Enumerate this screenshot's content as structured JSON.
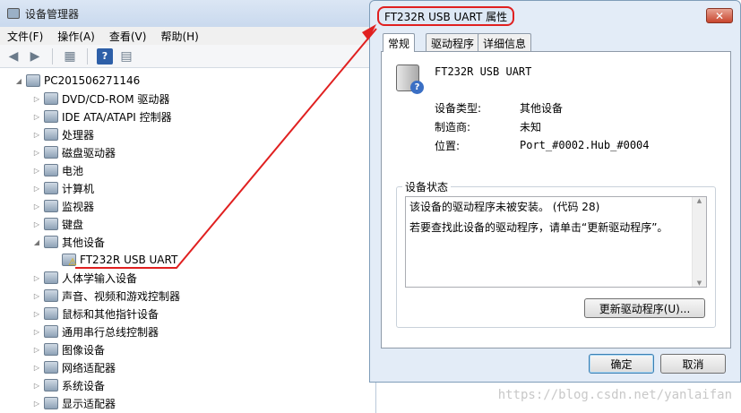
{
  "device_manager": {
    "title": "设备管理器",
    "menu": [
      "文件(F)",
      "操作(A)",
      "查看(V)",
      "帮助(H)"
    ],
    "root": "PC201506271146",
    "tree": [
      {
        "label": "DVD/CD-ROM 驱动器",
        "icon": "dvd-drive-icon"
      },
      {
        "label": "IDE ATA/ATAPI 控制器",
        "icon": "ide-controller-icon"
      },
      {
        "label": "处理器",
        "icon": "processor-icon"
      },
      {
        "label": "磁盘驱动器",
        "icon": "disk-drive-icon"
      },
      {
        "label": "电池",
        "icon": "battery-icon"
      },
      {
        "label": "计算机",
        "icon": "computer-icon"
      },
      {
        "label": "监视器",
        "icon": "monitor-icon"
      },
      {
        "label": "键盘",
        "icon": "keyboard-icon"
      },
      {
        "label": "其他设备",
        "icon": "other-devices-icon",
        "expanded": true
      },
      {
        "label": "FT232R USB UART",
        "icon": "warning-device-icon",
        "child": true
      },
      {
        "label": "人体学输入设备",
        "icon": "hid-icon"
      },
      {
        "label": "声音、视频和游戏控制器",
        "icon": "sound-icon"
      },
      {
        "label": "鼠标和其他指针设备",
        "icon": "mouse-icon"
      },
      {
        "label": "通用串行总线控制器",
        "icon": "usb-icon"
      },
      {
        "label": "图像设备",
        "icon": "imaging-icon"
      },
      {
        "label": "网络适配器",
        "icon": "network-icon"
      },
      {
        "label": "系统设备",
        "icon": "system-icon"
      },
      {
        "label": "显示适配器",
        "icon": "display-adapter-icon"
      }
    ]
  },
  "dialog": {
    "title": "FT232R USB UART 属性",
    "close_label": "✕",
    "tabs": [
      "常规",
      "驱动程序",
      "详细信息"
    ],
    "device_name": "FT232R USB UART",
    "fields": [
      {
        "label": "设备类型:",
        "value": "其他设备"
      },
      {
        "label": "制造商:",
        "value": "未知"
      },
      {
        "label": "位置:",
        "value": "Port_#0002.Hub_#0004"
      }
    ],
    "status_group": "设备状态",
    "status_line1": "该设备的驱动程序未被安装。 (代码 28)",
    "status_line2": "若要查找此设备的驱动程序，请单击“更新驱动程序”。",
    "update_button": "更新驱动程序(U)...",
    "ok_button": "确定",
    "cancel_button": "取消"
  },
  "watermark": "https://blog.csdn.net/yanlaifan",
  "colors": {
    "annotation": "#e02020",
    "accent": "#3c7fb1"
  }
}
